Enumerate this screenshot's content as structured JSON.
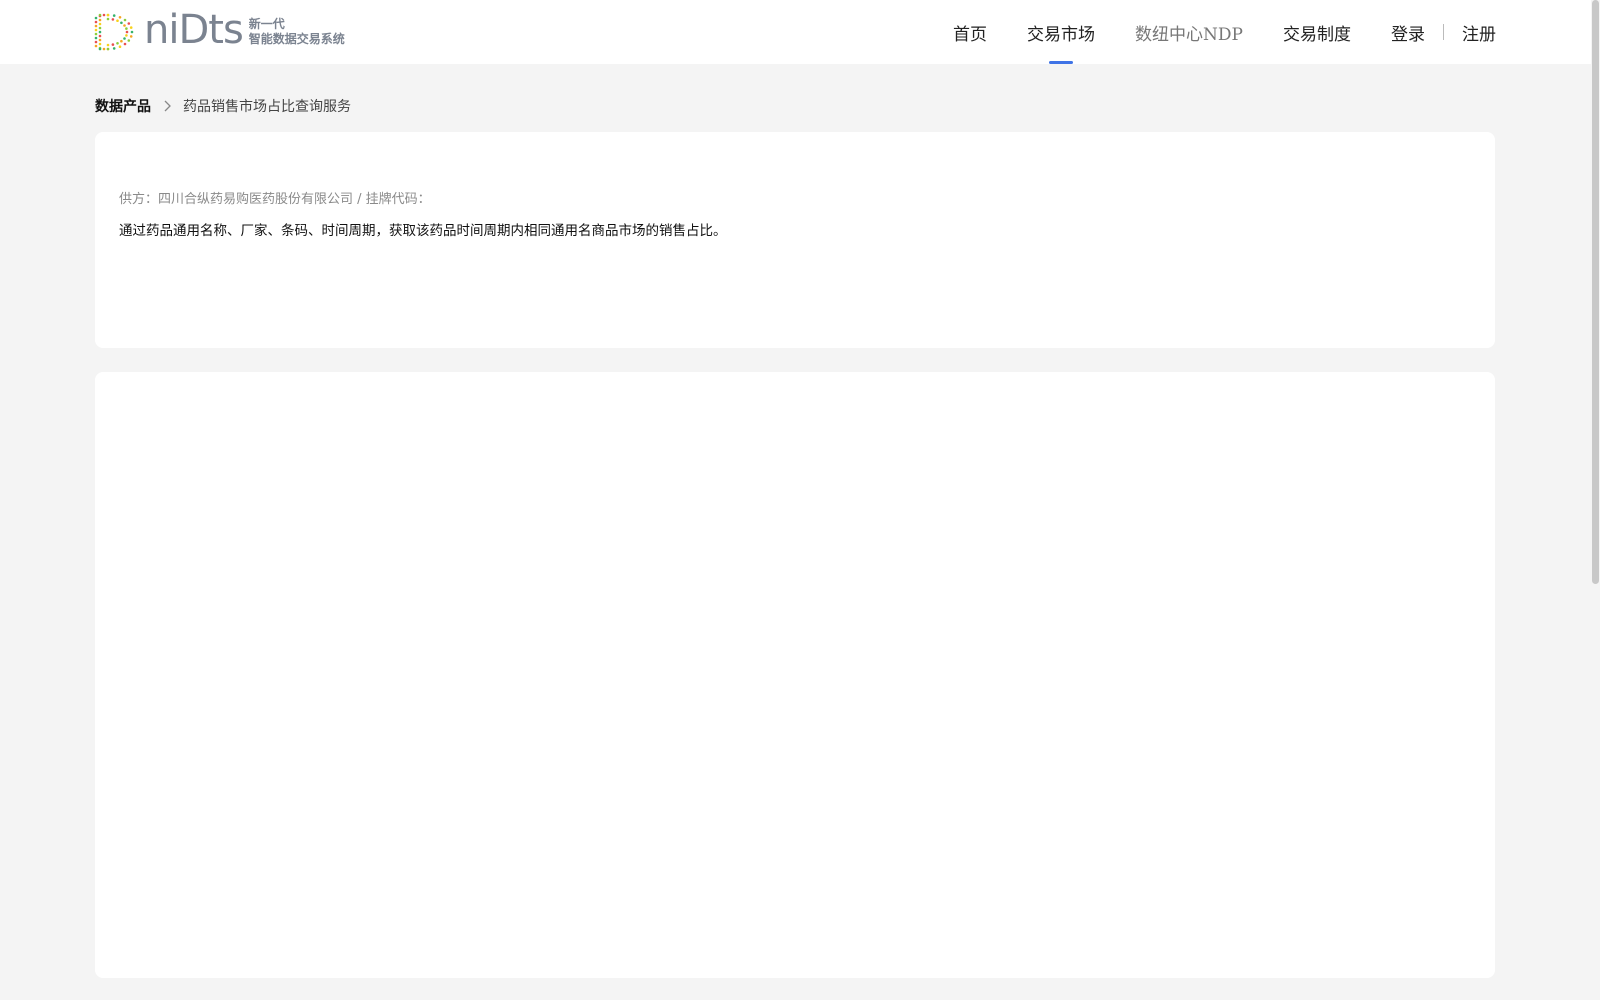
{
  "header": {
    "logo": {
      "wordmark": "niDts",
      "tagline_line1": "新一代",
      "tagline_line2": "智能数据交易系统",
      "colors": [
        "#e94f4f",
        "#f5a623",
        "#f8d21c",
        "#8ccf3a",
        "#35b36b"
      ]
    },
    "nav": {
      "items": [
        {
          "label": "首页",
          "active": false
        },
        {
          "label": "交易市场",
          "active": true
        },
        {
          "label": "数纽中心NDP",
          "active": false
        },
        {
          "label": "交易制度",
          "active": false
        }
      ],
      "login": "登录",
      "register": "注册"
    },
    "accent_color": "#3f73e6"
  },
  "breadcrumb": {
    "root": "数据产品",
    "current": "药品销售市场占比查询服务"
  },
  "product": {
    "supplier_line": "供方：四川合纵药易购医药股份有限公司 / 挂牌代码：",
    "description": "通过药品通用名称、厂家、条码、时间周期，获取该药品时间周期内相同通用名商品市场的销售占比。"
  }
}
